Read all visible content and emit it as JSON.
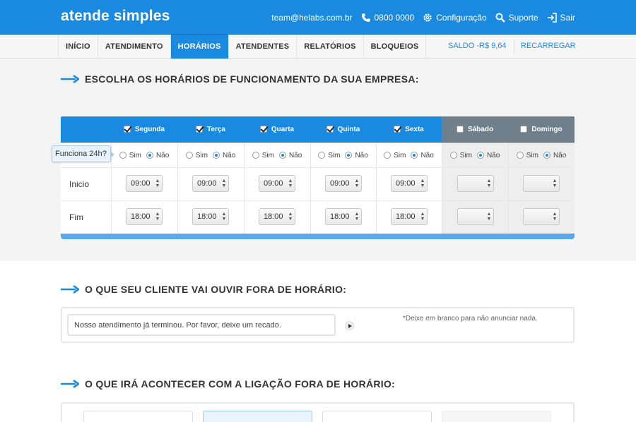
{
  "header": {
    "logo": "atende simples",
    "email": "team@helabs.com.br",
    "phone": "0800 0000",
    "config_label": "Configuração",
    "support_label": "Suporte",
    "exit_label": "Sair",
    "colors": {
      "primary": "#1a8ae0",
      "disabled_day": "#6f7f8c"
    }
  },
  "nav": {
    "tabs": [
      "INÍCIO",
      "ATENDIMENTO",
      "HORÁRIOS",
      "ATENDENTES",
      "RELATÓRIOS",
      "BLOQUEIOS"
    ],
    "active_tab": "HORÁRIOS",
    "saldo": "SALDO -R$ 9,64",
    "recarregar": "RECARREGAR"
  },
  "schedule": {
    "title": "ESCOLHA OS HORÁRIOS DE FUNCIONAMENTO DA SUA EMPRESA:",
    "tooltip": "Funciona 24h?",
    "yes_label": "Sim",
    "no_label": "Não",
    "start_label": "Inicio",
    "end_label": "Fim",
    "days": [
      {
        "name": "Segunda",
        "enabled": true,
        "full_day": "Não",
        "start": "09:00",
        "end": "18:00"
      },
      {
        "name": "Terça",
        "enabled": true,
        "full_day": "Não",
        "start": "09:00",
        "end": "18:00"
      },
      {
        "name": "Quarta",
        "enabled": true,
        "full_day": "Não",
        "start": "09:00",
        "end": "18:00"
      },
      {
        "name": "Quinta",
        "enabled": true,
        "full_day": "Não",
        "start": "09:00",
        "end": "18:00"
      },
      {
        "name": "Sexta",
        "enabled": true,
        "full_day": "Não",
        "start": "09:00",
        "end": "18:00"
      },
      {
        "name": "Sábado",
        "enabled": false,
        "full_day": "Não",
        "start": "",
        "end": ""
      },
      {
        "name": "Domingo",
        "enabled": false,
        "full_day": "Não",
        "start": "",
        "end": ""
      }
    ]
  },
  "offhours_message": {
    "title": "O QUE SEU CLIENTE VAI OUVIR FORA DE HORÁRIO:",
    "value": "Nosso atendimento já terminou. Por favor, deixe um recado.",
    "hint": "*Deixe em branco para não anunciar nada."
  },
  "offhours_action": {
    "title": "O QUE IRÁ ACONTECER COM A LIGAÇÃO FORA DE HORÁRIO:"
  }
}
